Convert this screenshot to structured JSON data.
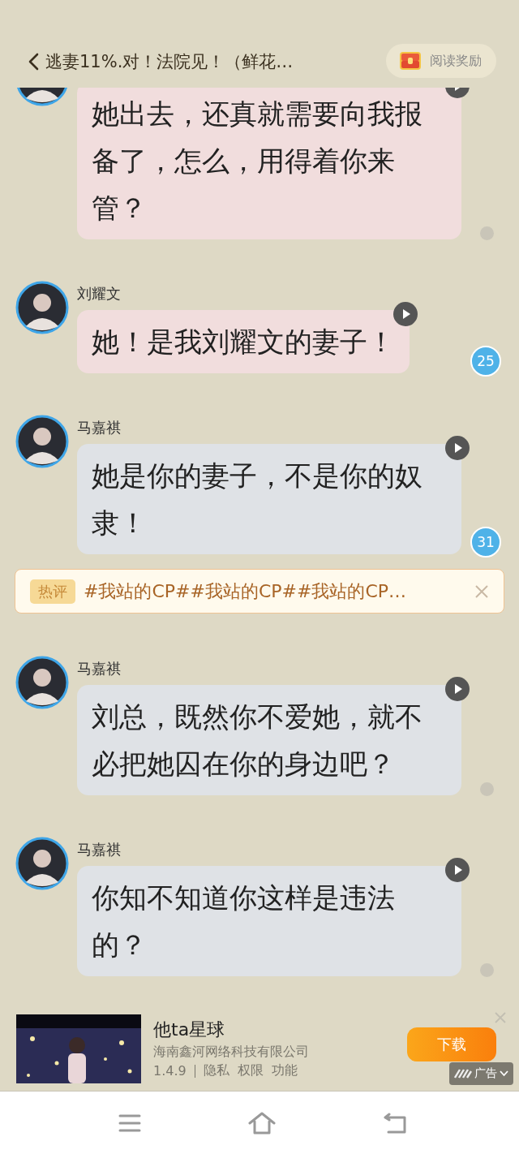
{
  "header": {
    "title": "逃妻11%.对！法院见！（鲜花…",
    "reward_button": "阅读奖励"
  },
  "feed": [
    {
      "kind": "message",
      "text": "她出去，还真就需要向我报备了，怎么，用得着你来管？",
      "color": "#f1dddd",
      "marker": {
        "kind": "dot"
      }
    },
    {
      "kind": "message",
      "name": "刘耀文",
      "text": "她！是我刘耀文的妻子！",
      "color": "#f1dddd",
      "marker": {
        "kind": "count",
        "count": "25"
      }
    },
    {
      "kind": "message",
      "name": "马嘉祺",
      "text": "她是你的妻子，不是你的奴隶！",
      "color": "#dfe2e6",
      "marker": {
        "kind": "count",
        "count": "31"
      }
    },
    {
      "kind": "hot_comment",
      "tag": "热评",
      "text": "#我站的CP##我站的CP##我站的CP…"
    },
    {
      "kind": "message",
      "name": "马嘉祺",
      "text": "刘总，既然你不爱她，就不必把她囚在你的身边吧？",
      "color": "#dfe2e6",
      "marker": {
        "kind": "dot"
      }
    },
    {
      "kind": "message",
      "name": "马嘉祺",
      "text": "你知不知道你这样是违法的？",
      "color": "#dfe2e6",
      "marker": {
        "kind": "dot"
      }
    }
  ],
  "ad": {
    "title": "他ta星球",
    "company": "海南鑫河网络科技有限公司",
    "version": "1.4.9",
    "links": [
      "隐私",
      "权限",
      "功能"
    ],
    "button": "下载",
    "label": "广告"
  }
}
